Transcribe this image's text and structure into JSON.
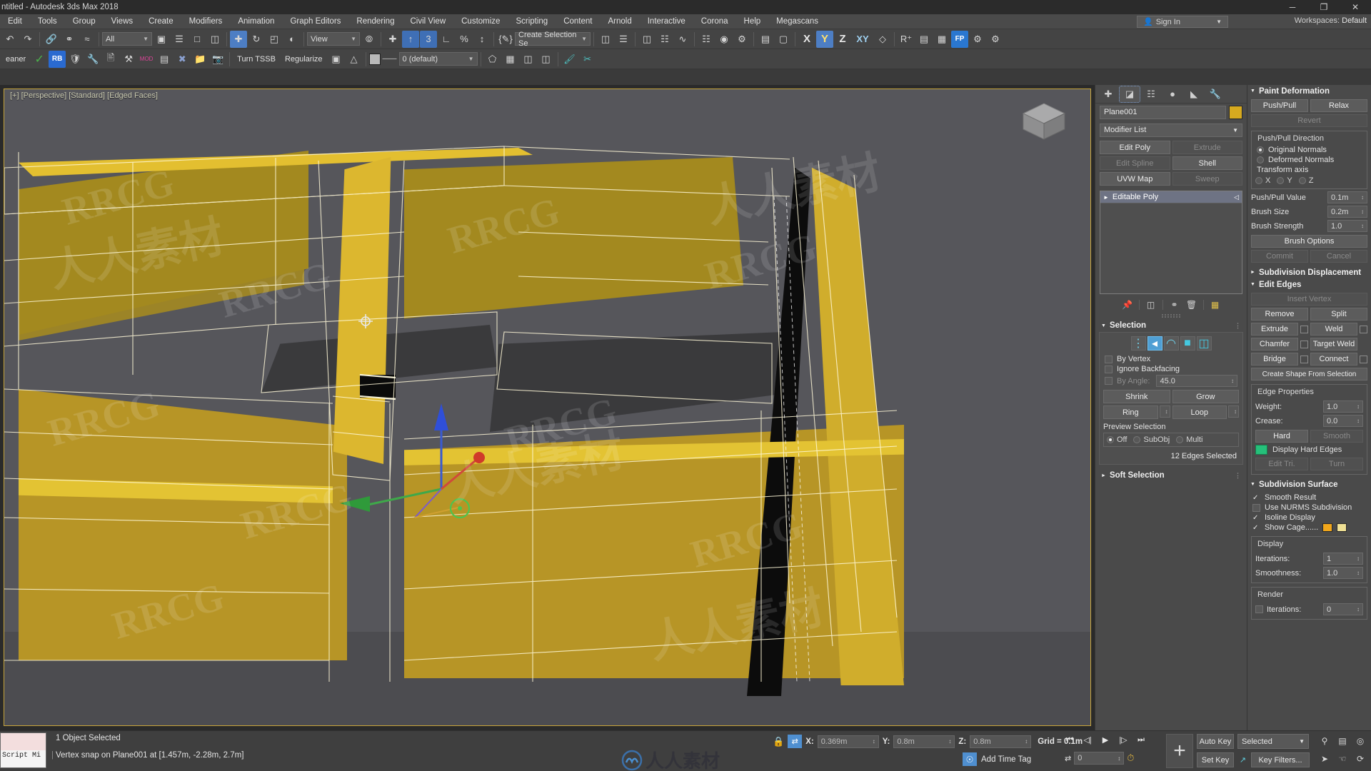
{
  "window": {
    "title": "ntitled - Autodesk 3ds Max 2018",
    "minimize": "─",
    "maximize": "❐",
    "close": "✕"
  },
  "menu": {
    "items": [
      "Edit",
      "Tools",
      "Group",
      "Views",
      "Create",
      "Modifiers",
      "Animation",
      "Graph Editors",
      "Rendering",
      "Civil View",
      "Customize",
      "Scripting",
      "Content",
      "Arnold",
      "Interactive",
      "Corona",
      "Help",
      "Megascans"
    ],
    "sign_in": "Sign In",
    "sign_in_icon": "user-icon",
    "workspaces_label": "Workspaces:",
    "workspaces_value": "Default"
  },
  "toolbar_main": {
    "undo_icon": "undo-icon",
    "redo_icon": "redo-icon",
    "link_icon": "select-and-link-icon",
    "unlink_icon": "unlink-icon",
    "bind_icon": "bind-to-space-warp-icon",
    "filter_value": "All",
    "select_object_icon": "select-object-icon",
    "select_by_name_icon": "select-by-name-icon",
    "region_rect_icon": "rectangular-selection-region-icon",
    "window_crossing_icon": "window-crossing-icon",
    "move_icon": "select-and-move-icon",
    "rotate_icon": "select-and-rotate-icon",
    "scale_icon": "select-and-scale-icon",
    "placement_icon": "placement-icon",
    "ref_coord_value": "View",
    "pivot_icon": "use-pivot-point-center-icon",
    "snap_toggle_icon": "snaps-toggle-icon",
    "angle_snap_icon": "angle-snap-toggle-icon",
    "percent_snap_icon": "percent-snap-toggle-icon",
    "spinner_snap_icon": "spinner-snap-toggle-icon",
    "edit_named_sets_icon": "edit-named-selection-sets-icon",
    "selection_set_value": "Create Selection Se",
    "mirror_icon": "mirror-icon",
    "align_icon": "align-icon",
    "layers_icon": "layer-explorer-icon",
    "curve_editor_icon": "curve-editor-icon",
    "schematic_icon": "schematic-view-icon",
    "material_editor_icon": "material-editor-icon",
    "render_setup_icon": "render-setup-icon",
    "render_frame_icon": "render-frame-window-icon",
    "render_icon": "render-production-icon",
    "x_label": "X",
    "y_label": "Y",
    "z_label": "Z",
    "xy_label": "XY",
    "project_folder_icon": "project-folder-icon",
    "slate_icon": "slate-material-editor-icon",
    "fp_label": "FP",
    "rt_icon": "render-to-texture-icon"
  },
  "toolbar_second": {
    "cleaner_label": "eaner",
    "check_icon": "green-check-icon",
    "rb_icon": "rb-plugin-icon",
    "shield_icon": "shield-icon",
    "wrench_icon": "wrench-icon",
    "doc_icon": "document-icon",
    "tool_icon": "tools-icon",
    "mod_icon": "mod-icon",
    "panel_icon": "panel-icon",
    "x_tool_icon": "x-tool-icon",
    "folder_icon": "folder-icon",
    "camera_icon": "camera-icon",
    "turn_tssb": "Turn TSSB",
    "regularize": "Regularize",
    "material_icon": "material-swatch-icon",
    "dropdown_value": "0 (default)",
    "quad_icon": "quad-icon",
    "tris_icon": "tris-icon",
    "ngon_icon": "ngon-icon"
  },
  "viewport": {
    "label": "[+] [Perspective] [Standard] [Edged Faces]",
    "viewcube_icon": "view-cube-icon",
    "watermarks_latin": [
      "RRCG",
      "RRCG",
      "RRCG",
      "RRCG",
      "RRCG",
      "RRCG",
      "RRCG",
      "RRCG",
      "RRCG"
    ],
    "watermark_cn": "人人素材",
    "gizmo": {
      "x_axis_color": "#d04a3a",
      "y_axis_color": "#3fa84a",
      "z_axis_color": "#3a5ad0"
    }
  },
  "command_panel": {
    "tabs": [
      {
        "name": "create-tab",
        "icon": "plus-icon",
        "active": false
      },
      {
        "name": "modify-tab",
        "icon": "modify-icon",
        "active": true
      },
      {
        "name": "hierarchy-tab",
        "icon": "hierarchy-icon",
        "active": false
      },
      {
        "name": "motion-tab",
        "icon": "motion-icon",
        "active": false
      },
      {
        "name": "display-tab",
        "icon": "display-icon",
        "active": false
      },
      {
        "name": "utilities-tab",
        "icon": "wrench-icon",
        "active": false
      }
    ],
    "object_name": "Plane001",
    "modifier_list": "Modifier List",
    "modifier_buttons": [
      {
        "label": "Edit Poly",
        "enabled": true
      },
      {
        "label": "Extrude",
        "enabled": false
      },
      {
        "label": "Edit Spline",
        "enabled": false
      },
      {
        "label": "Shell",
        "enabled": true
      },
      {
        "label": "UVW Map",
        "enabled": true
      },
      {
        "label": "Sweep",
        "enabled": false
      }
    ],
    "stack": [
      {
        "label": "Editable Poly",
        "expand_icon": "triangle-right-icon",
        "right_icon": "light-bulb-icon"
      }
    ],
    "stack_buttons": [
      {
        "name": "pin-stack-icon"
      },
      {
        "name": "show-end-result-icon"
      },
      {
        "name": "make-unique-icon"
      },
      {
        "name": "remove-modifier-icon"
      },
      {
        "name": "configure-modifier-sets-icon"
      }
    ],
    "selection": {
      "title": "Selection",
      "sub_object_icons": [
        {
          "name": "vertex-icon",
          "active": false
        },
        {
          "name": "edge-icon",
          "active": true
        },
        {
          "name": "border-icon",
          "active": false
        },
        {
          "name": "polygon-icon",
          "active": false
        },
        {
          "name": "element-icon",
          "active": false
        }
      ],
      "by_vertex": "By Vertex",
      "ignore_backfacing": "Ignore Backfacing",
      "by_angle_label": "By Angle:",
      "by_angle_value": "45.0",
      "shrink": "Shrink",
      "grow": "Grow",
      "ring": "Ring",
      "loop": "Loop",
      "preview_selection": "Preview Selection",
      "preview_options": [
        "Off",
        "SubObj",
        "Multi"
      ],
      "preview_selected": "Off",
      "info": "12 Edges Selected"
    },
    "soft_selection": "Soft Selection"
  },
  "right_panel": {
    "paint_deformation": {
      "title": "Paint Deformation",
      "push_pull": "Push/Pull",
      "relax": "Relax",
      "revert": "Revert",
      "direction_label": "Push/Pull Direction",
      "original_normals": "Original Normals",
      "deformed_normals": "Deformed Normals",
      "transform_axis": "Transform axis",
      "axes": [
        "X",
        "Y",
        "Z"
      ],
      "push_pull_value_label": "Push/Pull Value",
      "push_pull_value": "0.1m",
      "brush_size_label": "Brush Size",
      "brush_size": "0.2m",
      "brush_strength_label": "Brush Strength",
      "brush_strength": "1.0",
      "brush_options": "Brush Options",
      "commit": "Commit",
      "cancel": "Cancel"
    },
    "subdivision_displacement": "Subdivision Displacement",
    "edit_edges": {
      "title": "Edit Edges",
      "insert_vertex": "Insert Vertex",
      "remove": "Remove",
      "split": "Split",
      "extrude": "Extrude",
      "weld": "Weld",
      "chamfer": "Chamfer",
      "target_weld": "Target Weld",
      "bridge": "Bridge",
      "connect": "Connect",
      "create_shape": "Create Shape From Selection",
      "edge_properties": "Edge Properties",
      "weight_label": "Weight:",
      "weight_value": "1.0",
      "crease_label": "Crease:",
      "crease_value": "0.0",
      "hard": "Hard",
      "smooth": "Smooth",
      "display_hard_edges": "Display Hard Edges",
      "edit_tri": "Edit Tri.",
      "turn": "Turn"
    },
    "subdivision_surface": {
      "title": "Subdivision Surface",
      "smooth_result": "Smooth Result",
      "smooth_result_checked": true,
      "use_nurms": "Use NURMS Subdivision",
      "use_nurms_checked": false,
      "isoline_display": "Isoline Display",
      "isoline_checked": true,
      "show_cage": "Show Cage......",
      "show_cage_checked": true,
      "cage_color_1": "#f2a71b",
      "cage_color_2": "#efe094",
      "display_label": "Display",
      "display_iterations_label": "Iterations:",
      "display_iterations": "1",
      "smoothness_label": "Smoothness:",
      "smoothness": "1.0",
      "render_label": "Render",
      "render_iterations_label": "Iterations:",
      "render_iterations": "0"
    }
  },
  "status_bar": {
    "mini_listener_text": "Script Mi",
    "object_status": "1 Object Selected",
    "prompt": "Vertex snap on Plane001 at [1.457m, -2.28m, 2.7m]",
    "lock_icon": "selection-lock-icon",
    "absolute_mode_icon": "absolute-relative-mode-icon",
    "x_label": "X:",
    "x_value": "0.369m",
    "y_label": "Y:",
    "y_value": "0.8m",
    "z_label": "Z:",
    "z_value": "0.8m",
    "grid_text": "Grid = 0.1m",
    "add_time_tag": "Add Time Tag",
    "add_time_tag_icon": "time-tag-icon",
    "frame_value": "0",
    "key_mode_icon": "key-mode-toggle-icon",
    "transport": [
      {
        "name": "go-to-start-button",
        "icon": "⏮"
      },
      {
        "name": "previous-frame-button",
        "icon": "◁|"
      },
      {
        "name": "play-button",
        "icon": "▶"
      },
      {
        "name": "next-frame-button",
        "icon": "|▷"
      },
      {
        "name": "go-to-end-button",
        "icon": "⏭"
      }
    ],
    "set_key_plus": "+",
    "auto_key": "Auto Key",
    "set_key": "Set Key",
    "key_selected": "Selected",
    "key_filters": "Key Filters...",
    "nav_icons": [
      {
        "name": "zoom-icon",
        "glyph": "⌕"
      },
      {
        "name": "zoom-all-icon",
        "glyph": "⊞"
      },
      {
        "name": "zoom-extents-icon",
        "glyph": "⌖"
      },
      {
        "name": "field-of-view-icon",
        "glyph": "➤"
      },
      {
        "name": "walk-through-icon",
        "glyph": "Ὣ6"
      },
      {
        "name": "orbit-icon",
        "glyph": "↻"
      }
    ]
  }
}
